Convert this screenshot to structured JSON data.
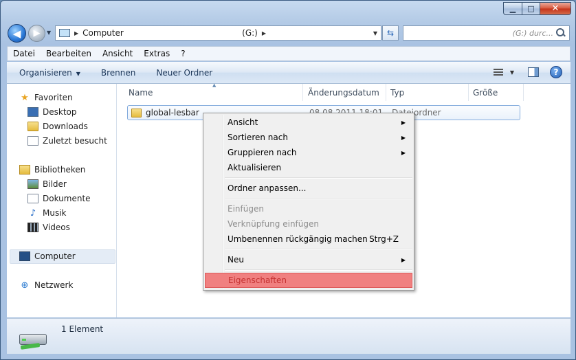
{
  "address": {
    "segments": [
      "Computer",
      "(G:)"
    ]
  },
  "search": {
    "placeholder": "(G:) durc..."
  },
  "menubar": [
    "Datei",
    "Bearbeiten",
    "Ansicht",
    "Extras",
    "?"
  ],
  "commandbar": {
    "organize": "Organisieren",
    "burn": "Brennen",
    "new_folder": "Neuer Ordner"
  },
  "nav": {
    "favorites": "Favoriten",
    "desktop": "Desktop",
    "downloads": "Downloads",
    "recent": "Zuletzt besucht",
    "libraries": "Bibliotheken",
    "pictures": "Bilder",
    "documents": "Dokumente",
    "music": "Musik",
    "videos": "Videos",
    "computer": "Computer",
    "network": "Netzwerk"
  },
  "columns": {
    "name": "Name",
    "date": "Änderungsdatum",
    "type": "Typ",
    "size": "Größe"
  },
  "files": [
    {
      "name": "global-lesbar",
      "date": "08.08.2011 18:01",
      "type": "Dateiordner"
    }
  ],
  "status": {
    "count": "1 Element"
  },
  "context_menu": {
    "view": "Ansicht",
    "sort_by": "Sortieren nach",
    "group_by": "Gruppieren nach",
    "refresh": "Aktualisieren",
    "customize": "Ordner anpassen...",
    "paste": "Einfügen",
    "paste_shortcut": "Verknüpfung einfügen",
    "undo_rename": "Umbenennen rückgängig machen",
    "undo_shortcut": "Strg+Z",
    "new": "Neu",
    "properties": "Eigenschaften"
  },
  "colors": {
    "highlight": "#f08080",
    "highlight_text": "#c43030"
  }
}
